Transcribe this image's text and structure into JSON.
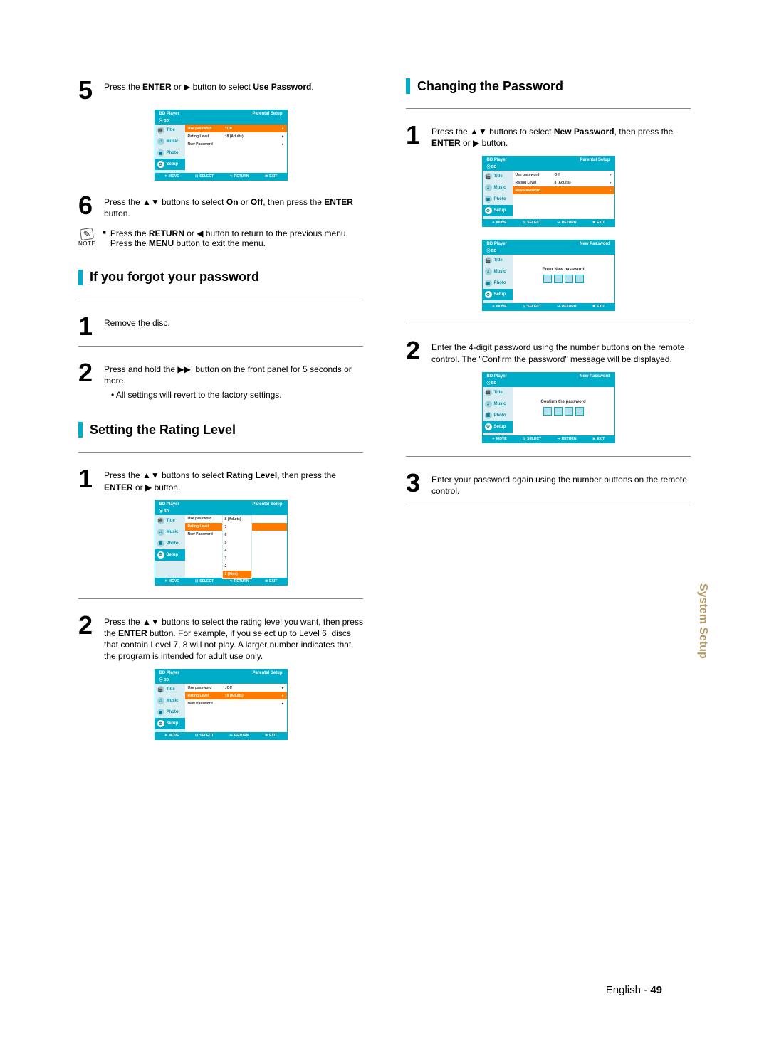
{
  "glyph": {
    "play": "▶",
    "updown": "▲▼",
    "left": "◀",
    "rightpipe": "▶▶|",
    "return": "↪",
    "enter": "⊡",
    "exit": "✖",
    "move": "✦",
    "disc": "⦿"
  },
  "sidebar": {
    "items": [
      "Title",
      "Music",
      "Photo",
      "Setup"
    ],
    "icons": [
      "🎬",
      "♫",
      "▣",
      "⚙"
    ]
  },
  "osd_common": {
    "player": "BD Player",
    "bd": "BD",
    "move": "MOVE",
    "select": "SELECT",
    "ret": "RETURN",
    "exit": "EXIT"
  },
  "osd_right_label": {
    "parental": "Parental Setup",
    "newpw": "New Password"
  },
  "osd_rows": {
    "use_password": "Use password",
    "rating_level": "Rating Level",
    "new_password": "New Password",
    "off": ": Off",
    "adults": ": 8 (Adults)"
  },
  "dropdown": {
    "adults": "8 (Adults)",
    "l7": "7",
    "l6": "6",
    "l5": "5",
    "l4": "4",
    "l3": "3",
    "l2": "2",
    "kids": "1 (Kids)"
  },
  "pw_msg": {
    "enter": "Enter New password",
    "confirm": "Confirm the password"
  },
  "left": {
    "step5_a": "Press the ",
    "step5_b": "ENTER",
    "step5_c": " or ",
    "step5_d": " button to select ",
    "step5_e": "Use Password",
    "step5_f": ".",
    "step6_a": "Press the ",
    "step6_b": " buttons to select ",
    "step6_c": "On",
    "step6_d": " or ",
    "step6_e": "Off",
    "step6_f": ", then press the ",
    "step6_g": "ENTER",
    "step6_h": " button.",
    "note_label": "NOTE",
    "note1_a": "Press the ",
    "note1_b": "RETURN",
    "note1_c": " or ",
    "note1_d": " button to return to the previous menu.",
    "note2_a": "Press the ",
    "note2_b": "MENU",
    "note2_c": " button to exit the menu.",
    "sec_forgot": "If you forgot your password",
    "f1": "Remove the disc.",
    "f2_a": "Press and hold the ",
    "f2_b": " button on the front panel for 5 seconds or more.",
    "f2_bullet": "All settings will revert to the factory settings.",
    "sec_rating": "Setting the Rating Level",
    "r1_a": "Press the ",
    "r1_b": " buttons to select ",
    "r1_c": "Rating Level",
    "r1_d": ", then press the ",
    "r1_e": "ENTER",
    "r1_f": " or ",
    "r1_g": " button.",
    "r2_a": "Press the ",
    "r2_b": " buttons to select the rating level you want, then press the ",
    "r2_c": "ENTER",
    "r2_d": " button. For example, if you select up to Level 6, discs that contain Level 7, 8 will not play. A larger number indicates that the program is intended for adult use only."
  },
  "right": {
    "sec_change": "Changing the Password",
    "c1_a": "Press the ",
    "c1_b": " buttons to select ",
    "c1_c": "New Password",
    "c1_d": ", then press the ",
    "c1_e": "ENTER",
    "c1_f": " or ",
    "c1_g": " button.",
    "c2": "Enter the 4-digit password using the number buttons on the remote control. The \"Confirm the password\" message will be displayed.",
    "c3": "Enter your password again using the number buttons on the remote control."
  },
  "sidetab": "System Setup",
  "footer": {
    "lang": "English - ",
    "page": "49"
  }
}
